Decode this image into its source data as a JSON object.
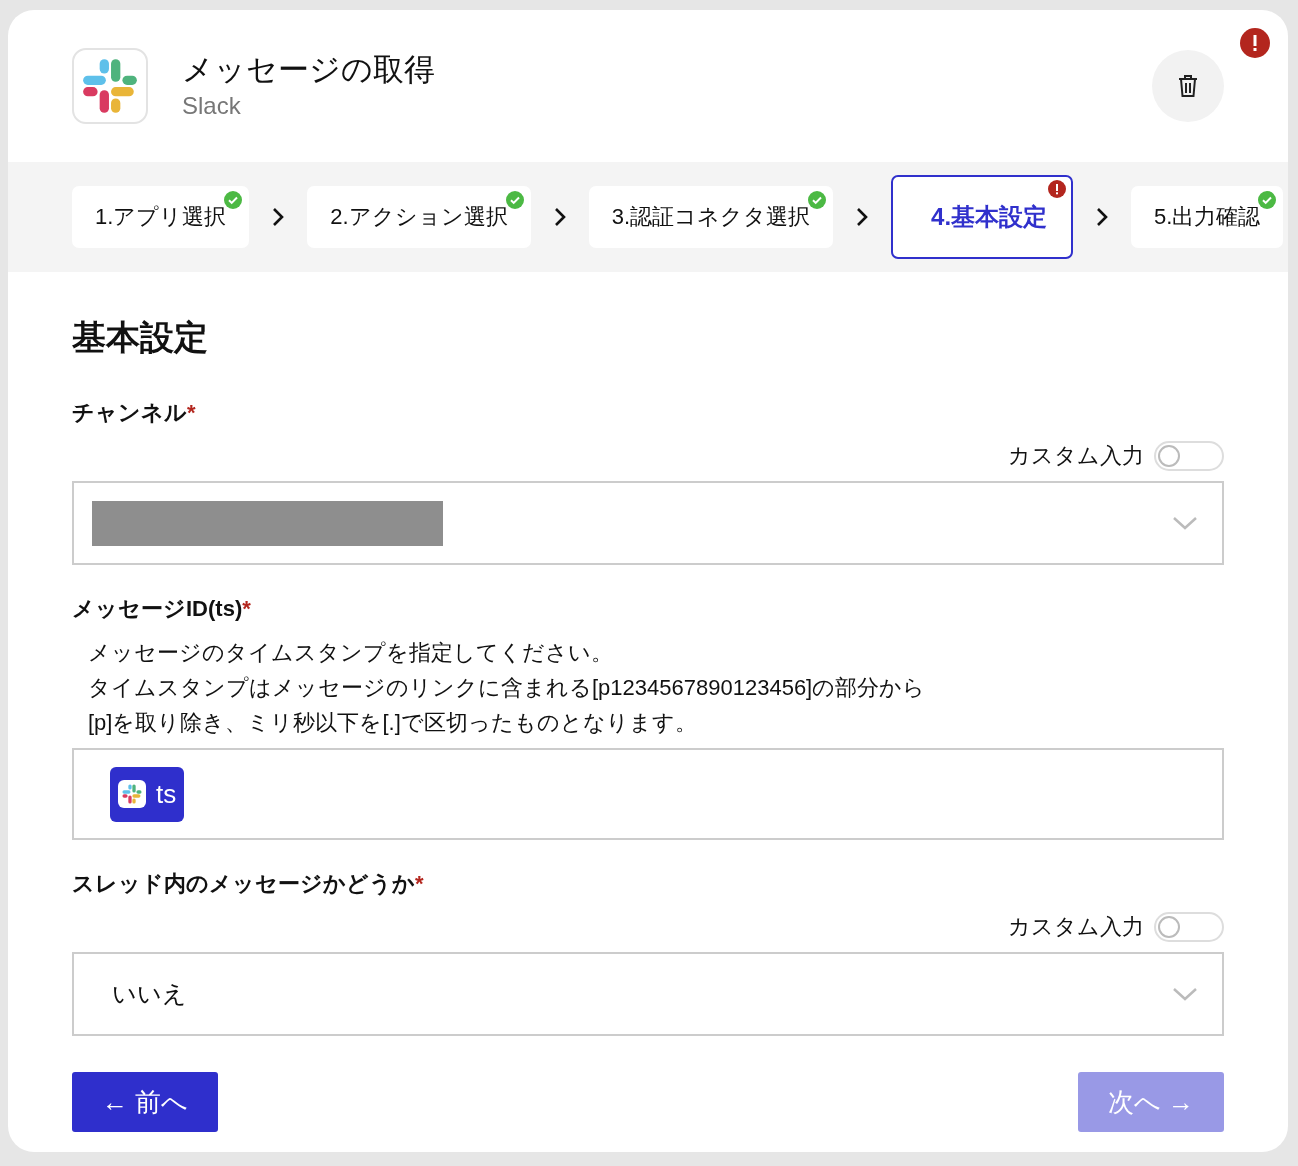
{
  "header": {
    "title": "メッセージの取得",
    "app": "Slack",
    "alert": true
  },
  "steps": [
    {
      "label": "1.アプリ選択",
      "complete": true,
      "selected": false
    },
    {
      "label": "2.アクション選択",
      "complete": true,
      "selected": false
    },
    {
      "label": "3.認証コネクタ選択",
      "complete": true,
      "selected": false
    },
    {
      "label": "4.基本設定",
      "complete": false,
      "selected": true
    },
    {
      "label": "5.出力確認",
      "complete": true,
      "selected": false
    }
  ],
  "section_title": "基本設定",
  "fields": [
    {
      "kind": "select",
      "label": "チャンネル",
      "required_mark": "*",
      "custom_input": {
        "label": "カスタム入力",
        "on": false
      },
      "redacted": true
    },
    {
      "kind": "token",
      "label": "メッセージID(ts)",
      "required_mark": "*",
      "description": [
        "メッセージのタイムスタンプを指定してください。",
        "タイムスタンプはメッセージのリンクに含まれる[p1234567890123456]の部分から",
        "[p]を取り除き、ミリ秒以下を[.]で区切ったものとなります。"
      ],
      "token": {
        "label": "ts"
      }
    },
    {
      "kind": "select",
      "label": "スレッド内のメッセージかどうか",
      "required_mark": "*",
      "custom_input": {
        "label": "カスタム入力",
        "on": false
      },
      "value": "いいえ"
    }
  ],
  "buttons": [
    {
      "kind": "back",
      "label": "← 前へ",
      "disabled": false
    },
    {
      "kind": "next",
      "label": "次へ →",
      "disabled": true
    }
  ]
}
